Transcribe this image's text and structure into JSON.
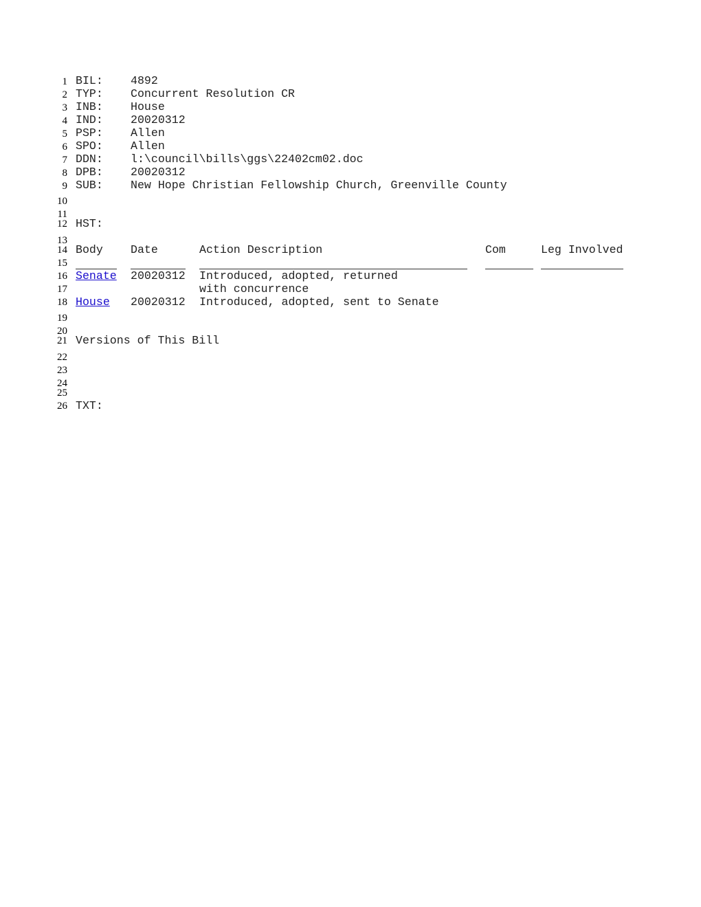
{
  "line_numbers": [
    "1",
    "2",
    "3",
    "4",
    "5",
    "6",
    "7",
    "8",
    "9",
    "10",
    "11",
    "12",
    "13",
    "14",
    "15",
    "16",
    "17",
    "18",
    "19",
    "20",
    "21",
    "22",
    "23",
    "24",
    "25",
    "26"
  ],
  "fields": [
    {
      "label": "BIL:",
      "value": "4892"
    },
    {
      "label": "TYP:",
      "value": "Concurrent Resolution CR"
    },
    {
      "label": "INB:",
      "value": "House"
    },
    {
      "label": "IND:",
      "value": "20020312"
    },
    {
      "label": "PSP:",
      "value": "Allen"
    },
    {
      "label": "SPO:",
      "value": "Allen"
    },
    {
      "label": "DDN:",
      "value": "l:\\council\\bills\\ggs\\22402cm02.doc"
    },
    {
      "label": "DPB:",
      "value": "20020312"
    },
    {
      "label": "SUB:",
      "value": "New Hope Christian Fellowship Church, Greenville County"
    }
  ],
  "history": {
    "label": "HST:",
    "columns": [
      "Body",
      "Date",
      "Action Description",
      "Com",
      "Leg Involved"
    ],
    "rows": [
      {
        "body": "Senate",
        "date": "20020312",
        "action": "Introduced, adopted, returned",
        "action_cont": "with concurrence"
      },
      {
        "body": "House",
        "date": "20020312",
        "action": "Introduced, adopted, sent to Senate"
      }
    ]
  },
  "versions_label": "Versions of This Bill",
  "text_label": "TXT:"
}
